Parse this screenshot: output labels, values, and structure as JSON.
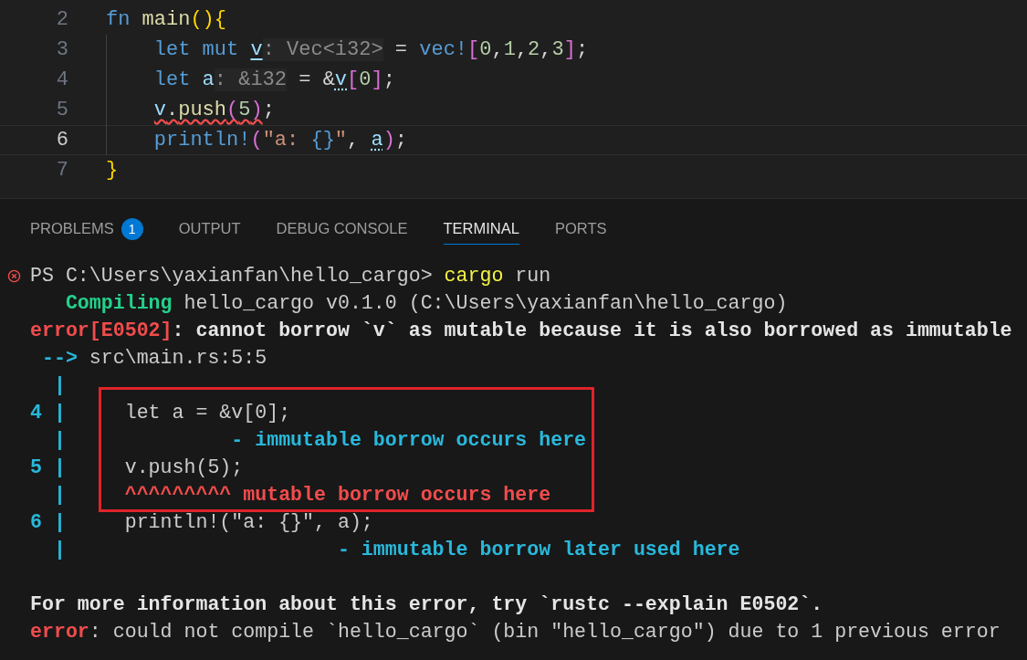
{
  "editor": {
    "lines": [
      {
        "number": "2",
        "current": false,
        "tokens": [
          {
            "kind": "kw",
            "text": "fn "
          },
          {
            "kind": "fn",
            "text": "main"
          },
          {
            "kind": "br1",
            "text": "(){"
          }
        ]
      },
      {
        "number": "3",
        "current": false,
        "tokens": [
          {
            "kind": "kw",
            "text": "    let mut "
          },
          {
            "kind": "var",
            "text": "v",
            "underlined": true
          },
          {
            "kind": "hint",
            "text": ": Vec<i32>"
          },
          {
            "kind": "punct",
            "text": " = "
          },
          {
            "kind": "kw",
            "text": "vec!"
          },
          {
            "kind": "br2",
            "text": "["
          },
          {
            "kind": "num",
            "text": "0"
          },
          {
            "kind": "punct",
            "text": ","
          },
          {
            "kind": "num",
            "text": "1"
          },
          {
            "kind": "punct",
            "text": ","
          },
          {
            "kind": "num",
            "text": "2"
          },
          {
            "kind": "punct",
            "text": ","
          },
          {
            "kind": "num",
            "text": "3"
          },
          {
            "kind": "br2",
            "text": "]"
          },
          {
            "kind": "punct",
            "text": ";"
          }
        ]
      },
      {
        "number": "4",
        "current": false,
        "tokens": [
          {
            "kind": "kw",
            "text": "    let "
          },
          {
            "kind": "var",
            "text": "a"
          },
          {
            "kind": "hint",
            "text": ": &i32"
          },
          {
            "kind": "punct",
            "text": " = &"
          },
          {
            "kind": "var",
            "text": "v",
            "dotted": true
          },
          {
            "kind": "br2",
            "text": "["
          },
          {
            "kind": "num",
            "text": "0"
          },
          {
            "kind": "br2",
            "text": "]"
          },
          {
            "kind": "punct",
            "text": ";"
          }
        ]
      },
      {
        "number": "5",
        "current": false,
        "tokens": [
          {
            "kind": "var",
            "text": "    v",
            "squiggly": true
          },
          {
            "kind": "punct",
            "text": ".",
            "squiggly": true
          },
          {
            "kind": "fn",
            "text": "push",
            "squiggly": true
          },
          {
            "kind": "br2",
            "text": "(",
            "squiggly": true
          },
          {
            "kind": "num",
            "text": "5",
            "squiggly": true
          },
          {
            "kind": "br2",
            "text": ")",
            "squiggly": true
          },
          {
            "kind": "punct",
            "text": ";"
          }
        ]
      },
      {
        "number": "6",
        "current": true,
        "tokens": [
          {
            "kind": "kw",
            "text": "    println!"
          },
          {
            "kind": "br2",
            "text": "("
          },
          {
            "kind": "str",
            "text": "\"a: "
          },
          {
            "kind": "kw",
            "text": "{}"
          },
          {
            "kind": "str",
            "text": "\""
          },
          {
            "kind": "punct",
            "text": ", "
          },
          {
            "kind": "var",
            "text": "a",
            "dotted": true
          },
          {
            "kind": "br2",
            "text": ")"
          },
          {
            "kind": "punct",
            "text": ";"
          }
        ]
      },
      {
        "number": "7",
        "current": false,
        "tokens": [
          {
            "kind": "br1",
            "text": "}"
          }
        ]
      }
    ]
  },
  "panel": {
    "tabs": [
      {
        "label": "PROBLEMS",
        "badge": "1",
        "selected": false
      },
      {
        "label": "OUTPUT",
        "selected": false
      },
      {
        "label": "DEBUG CONSOLE",
        "selected": false
      },
      {
        "label": "TERMINAL",
        "selected": true
      },
      {
        "label": "PORTS",
        "selected": false
      }
    ]
  },
  "terminal": {
    "lines": [
      {
        "kind": "prompt",
        "failed": true,
        "segments": [
          {
            "kind": "plain",
            "text": "PS C:\\Users\\yaxianfan\\hello_cargo> "
          },
          {
            "kind": "command",
            "text": "cargo"
          },
          {
            "kind": "plain",
            "text": " run"
          }
        ]
      },
      {
        "kind": "output",
        "segments": [
          {
            "kind": "status",
            "text": "   Compiling"
          },
          {
            "kind": "plain",
            "text": " hello_cargo v0.1.0 (C:\\Users\\yaxianfan\\hello_cargo)"
          }
        ]
      },
      {
        "kind": "output",
        "segments": [
          {
            "kind": "error",
            "text": "error[E0502]"
          },
          {
            "kind": "emphasis",
            "text": ": cannot borrow `v` as mutable because it is also borrowed as immutable"
          }
        ]
      },
      {
        "kind": "output",
        "segments": [
          {
            "kind": "gutter",
            "text": " -->"
          },
          {
            "kind": "plain",
            "text": " src\\main.rs:5:5"
          }
        ]
      },
      {
        "kind": "output",
        "segments": [
          {
            "kind": "gutter",
            "text": "  |"
          }
        ]
      },
      {
        "kind": "output",
        "segments": [
          {
            "kind": "gutter",
            "text": "4 |"
          },
          {
            "kind": "plain",
            "text": "     let a = &v[0];"
          }
        ]
      },
      {
        "kind": "output",
        "segments": [
          {
            "kind": "gutter",
            "text": "  |"
          },
          {
            "kind": "note",
            "text": "              - immutable borrow occurs here"
          }
        ]
      },
      {
        "kind": "output",
        "segments": [
          {
            "kind": "gutter",
            "text": "5 |"
          },
          {
            "kind": "plain",
            "text": "     v.push(5);"
          }
        ]
      },
      {
        "kind": "output",
        "segments": [
          {
            "kind": "gutter",
            "text": "  |"
          },
          {
            "kind": "error",
            "text": "     ^^^^^^^^^ mutable borrow occurs here"
          }
        ]
      },
      {
        "kind": "output",
        "segments": [
          {
            "kind": "gutter",
            "text": "6 |"
          },
          {
            "kind": "plain",
            "text": "     println!(\"a: {}\", a);"
          }
        ]
      },
      {
        "kind": "output",
        "segments": [
          {
            "kind": "gutter",
            "text": "  |"
          },
          {
            "kind": "note",
            "text": "                       - immutable borrow later used here"
          }
        ]
      },
      {
        "kind": "summary",
        "segments": [
          {
            "kind": "emphasis",
            "text": "For more information about this error, try `rustc --explain E0502`."
          }
        ]
      },
      {
        "kind": "output",
        "segments": [
          {
            "kind": "error",
            "text": "error"
          },
          {
            "kind": "plain",
            "text": ": could not compile `hello_cargo` (bin \"hello_cargo\") due to 1 previous error"
          }
        ]
      }
    ]
  }
}
